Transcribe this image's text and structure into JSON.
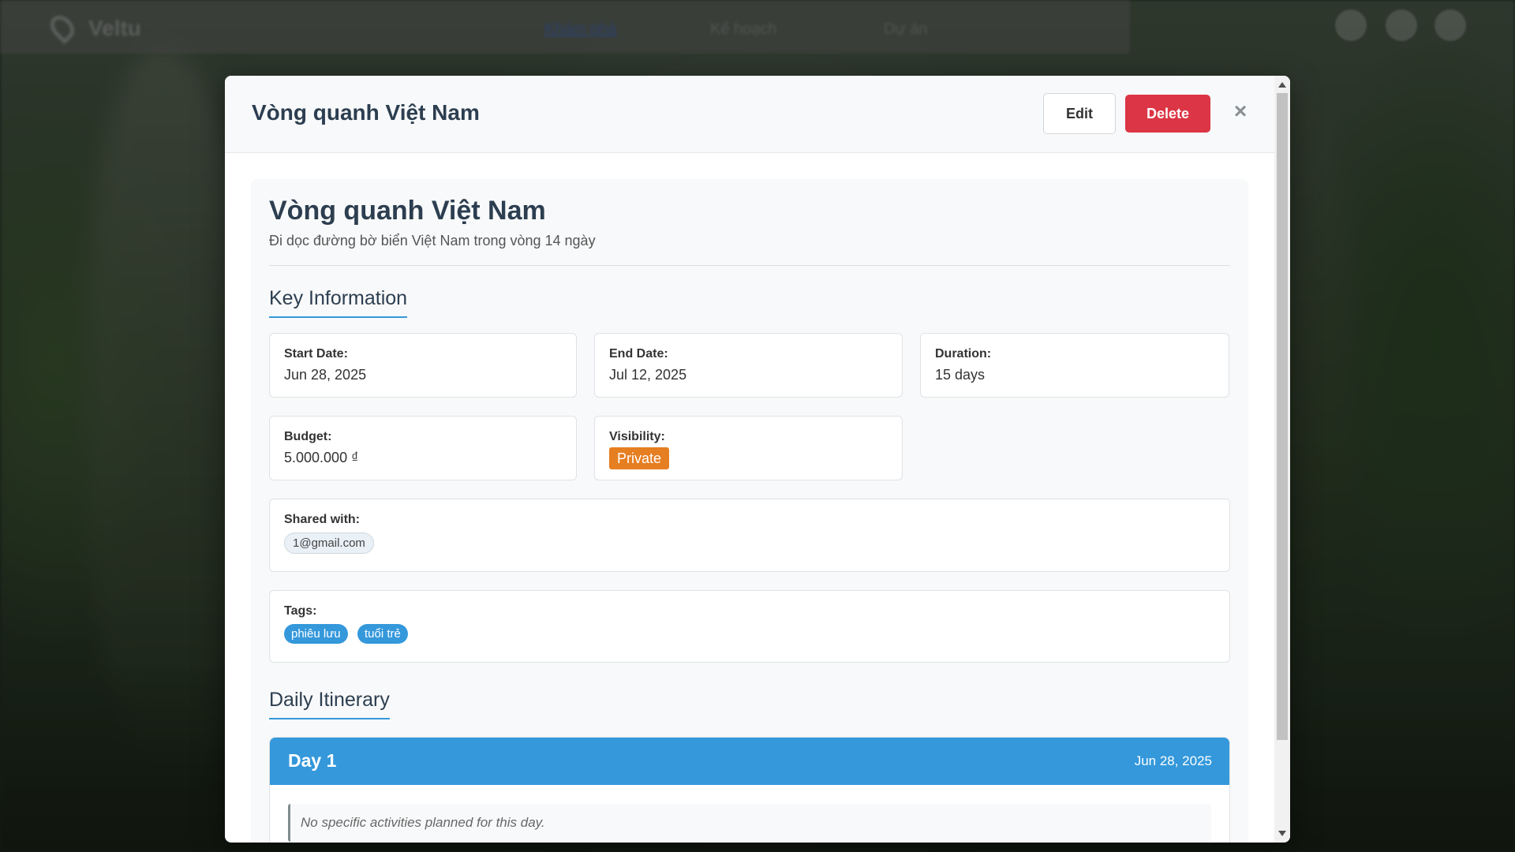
{
  "navbar": {
    "brand": "Veltu",
    "links": [
      "Khám phá",
      "Kế hoạch",
      "Dự án"
    ]
  },
  "modal": {
    "title": "Vòng quanh Việt Nam",
    "edit_label": "Edit",
    "delete_label": "Delete",
    "close_label": "×"
  },
  "trip": {
    "title": "Vòng quanh Việt Nam",
    "description": "Đi dọc đường bờ biển Việt Nam trong vòng 14 ngày"
  },
  "key_info": {
    "heading": "Key Information",
    "start_label": "Start Date:",
    "start_value": "Jun 28, 2025",
    "end_label": "End Date:",
    "end_value": "Jul 12, 2025",
    "duration_label": "Duration:",
    "duration_value": "15 days",
    "budget_label": "Budget:",
    "budget_value": "5.000.000 ₫",
    "visibility_label": "Visibility:",
    "visibility_value": "Private",
    "shared_label": "Shared with:",
    "shared_with": [
      "1@gmail.com"
    ],
    "tags_label": "Tags:",
    "tags": [
      "phiêu lưu",
      "tuổi trẻ"
    ]
  },
  "itinerary": {
    "heading": "Daily Itinerary",
    "days": [
      {
        "title": "Day 1",
        "date": "Jun 28, 2025",
        "empty_text": "No specific activities planned for this day."
      }
    ]
  },
  "colors": {
    "primary": "#3498db",
    "danger": "#dc3545",
    "private_badge": "#e67e22",
    "heading": "#2c3e50"
  }
}
